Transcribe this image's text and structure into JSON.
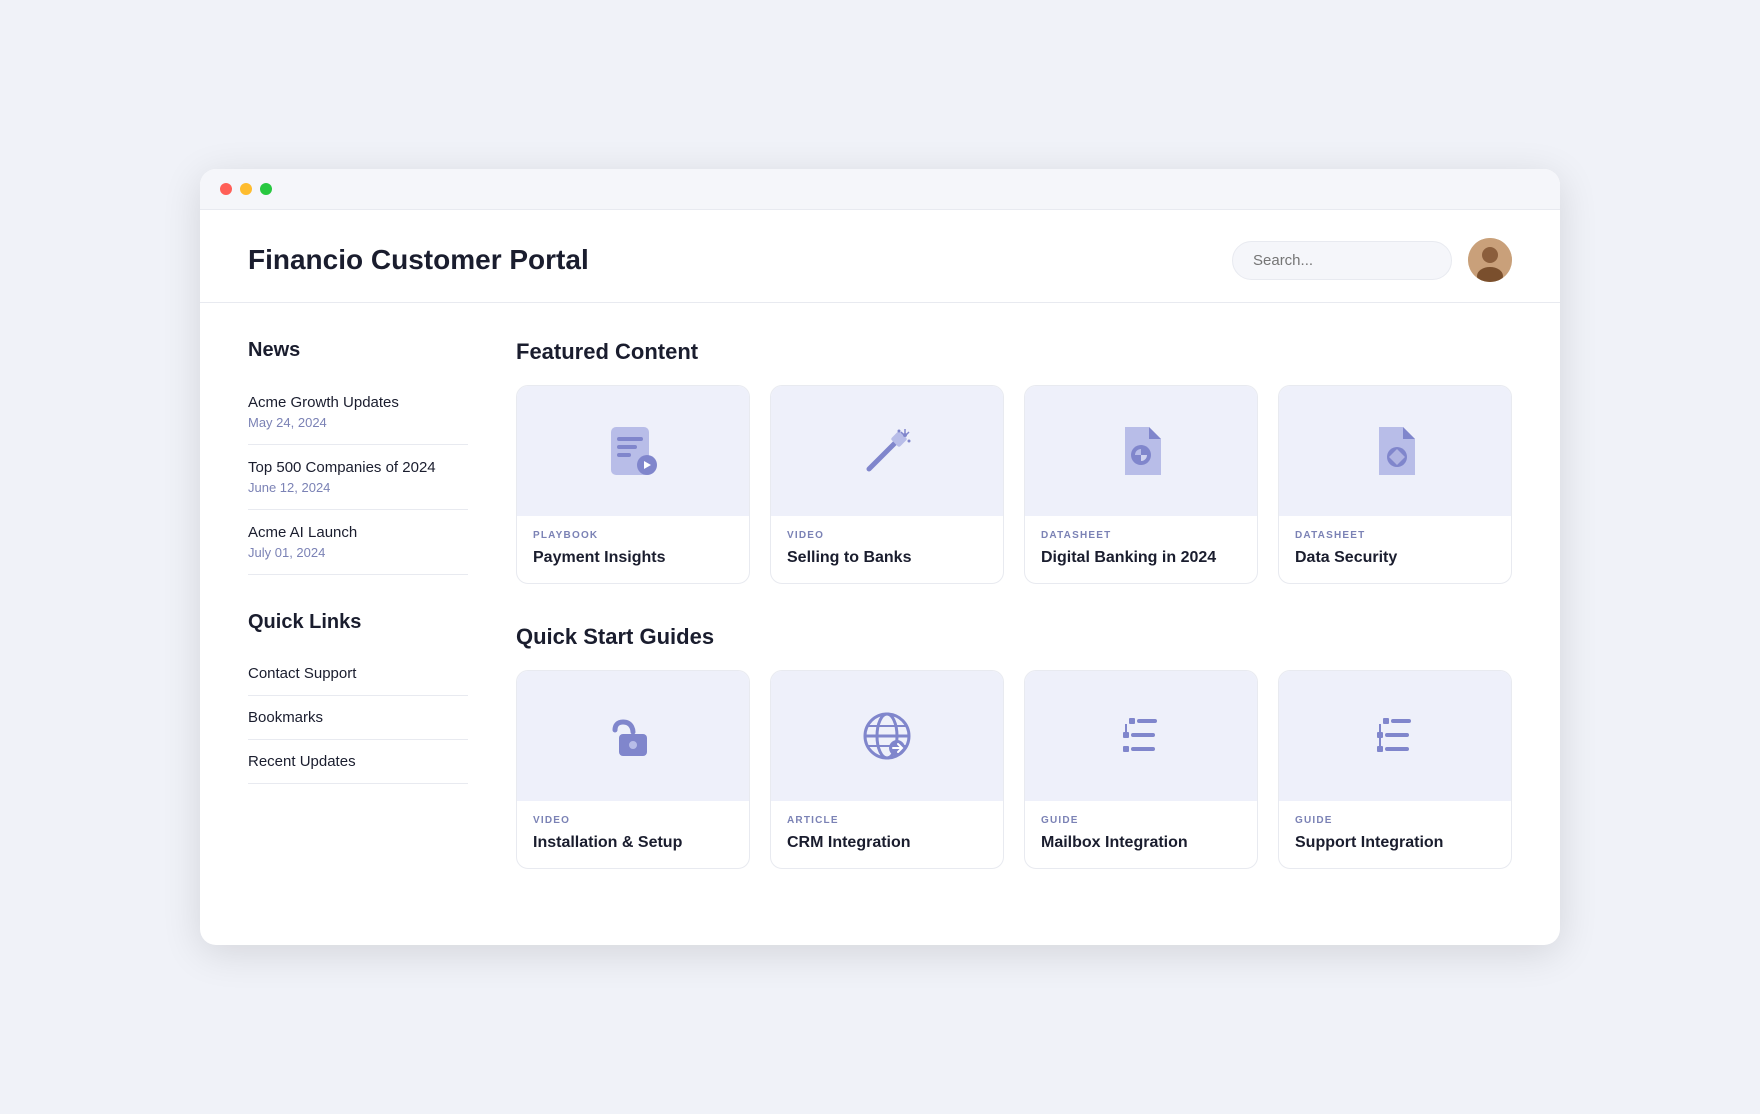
{
  "window": {
    "title": "Financio Customer Portal"
  },
  "header": {
    "title": "Financio Customer Portal",
    "search_placeholder": "Search...",
    "avatar_alt": "User avatar"
  },
  "sidebar": {
    "news_section_title": "News",
    "news_items": [
      {
        "title": "Acme Growth Updates",
        "date": "May 24, 2024"
      },
      {
        "title": "Top 500 Companies of 2024",
        "date": "June 12, 2024"
      },
      {
        "title": "Acme AI Launch",
        "date": "July 01, 2024"
      }
    ],
    "quick_links_title": "Quick Links",
    "quick_links": [
      {
        "label": "Contact Support"
      },
      {
        "label": "Bookmarks"
      },
      {
        "label": "Recent Updates"
      }
    ]
  },
  "featured": {
    "section_title": "Featured Content",
    "cards": [
      {
        "type": "PLAYBOOK",
        "title": "Payment Insights",
        "icon": "playbook"
      },
      {
        "type": "VIDEO",
        "title": "Selling to Banks",
        "icon": "video"
      },
      {
        "type": "DATASHEET",
        "title": "Digital Banking in 2024",
        "icon": "datasheet1"
      },
      {
        "type": "DATASHEET",
        "title": "Data Security",
        "icon": "datasheet2"
      }
    ]
  },
  "quickstart": {
    "section_title": "Quick Start Guides",
    "cards": [
      {
        "type": "VIDEO",
        "title": "Installation & Setup",
        "icon": "lock"
      },
      {
        "type": "ARTICLE",
        "title": "CRM Integration",
        "icon": "globe"
      },
      {
        "type": "GUIDE",
        "title": "Mailbox Integration",
        "icon": "mailbox"
      },
      {
        "type": "GUIDE",
        "title": "Support Integration",
        "icon": "support"
      }
    ]
  }
}
